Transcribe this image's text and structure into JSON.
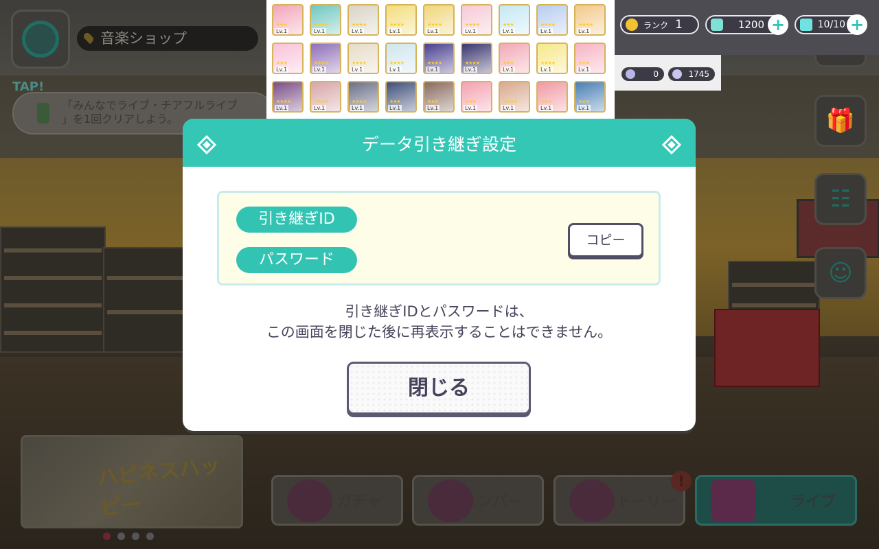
{
  "shop": {
    "title": "音楽ショップ",
    "tap_label": "TAP!"
  },
  "mission": {
    "line1": "「みんなでライブ・チアフルライブ",
    "line2": "」を1回クリアしよう。"
  },
  "status": {
    "rank_label": "ランク",
    "rank_value": "1",
    "crystals": "1200",
    "stamina": "10/10",
    "plus": "+",
    "notes": "0",
    "gems": "1745"
  },
  "cards": [
    {
      "stars": "★★★",
      "bg": "#f4a6b8"
    },
    {
      "stars": "★★★★",
      "bg": "#6fc7c0"
    },
    {
      "stars": "★★★★",
      "bg": "#d9d4c6"
    },
    {
      "stars": "★★★★",
      "bg": "#f3dd7c"
    },
    {
      "stars": "★★★★",
      "bg": "#f0d67b"
    },
    {
      "stars": "★★★★",
      "bg": "#f6c9d6"
    },
    {
      "stars": "★★★",
      "bg": "#c6e8f4"
    },
    {
      "stars": "★★★★",
      "bg": "#b8cdf0"
    },
    {
      "stars": "★★★★",
      "bg": "#f3c98a"
    },
    {
      "stars": "★★★",
      "bg": "#f9c2d8"
    },
    {
      "stars": "★★★★",
      "bg": "#8f6fb8"
    },
    {
      "stars": "★★★★",
      "bg": "#e6dcc8"
    },
    {
      "stars": "★★★★",
      "bg": "#cfe6ee"
    },
    {
      "stars": "★★★★",
      "bg": "#4a3f8e"
    },
    {
      "stars": "★★★★",
      "bg": "#3b3670"
    },
    {
      "stars": "★★★",
      "bg": "#f2a9b6"
    },
    {
      "stars": "★★★★",
      "bg": "#f6e88a"
    },
    {
      "stars": "★★★",
      "bg": "#f7b4c4"
    },
    {
      "stars": "★★★★",
      "bg": "#7a4f86"
    },
    {
      "stars": "★★★★",
      "bg": "#d6a5a9"
    },
    {
      "stars": "★★★★",
      "bg": "#6b7088"
    },
    {
      "stars": "★★★",
      "bg": "#3e4f7a"
    },
    {
      "stars": "★★★",
      "bg": "#8a6b5e"
    },
    {
      "stars": "★★★",
      "bg": "#f4a2b2"
    },
    {
      "stars": "★★★★",
      "bg": "#d9a98e"
    },
    {
      "stars": "★★★",
      "bg": "#f09aa4"
    },
    {
      "stars": "★★★",
      "bg": "#4a7fb5"
    }
  ],
  "card_level": "Lv.1",
  "dialog": {
    "title": "データ引き継ぎ設定",
    "id_label": "引き継ぎID",
    "password_label": "パスワード",
    "copy_label": "コピー",
    "notice_line1": "引き継ぎIDとパスワードは、",
    "notice_line2": "この画面を閉じた後に再表示することはできません。",
    "close_label": "閉じる"
  },
  "nav": {
    "gacha": "ガチャ",
    "member": "メンバー",
    "story": "ストーリー",
    "live": "ライブ",
    "story_alert": "!"
  },
  "banner": {
    "logo_text": "ハピネスハッピー"
  },
  "icons": {
    "globe": "globe-icon",
    "gift": "gift-icon",
    "mission": "mission-list-icon",
    "friends": "friends-icon",
    "note": "music-note-icon",
    "crystal": "crystal-icon",
    "stamina": "stamina-icon"
  },
  "colors": {
    "accent": "#34c7b6",
    "dialog_text": "#44435a",
    "button_border": "#4f4e66"
  }
}
